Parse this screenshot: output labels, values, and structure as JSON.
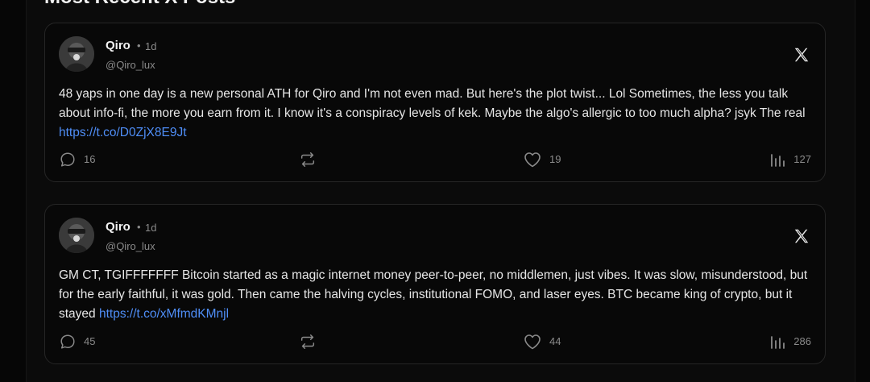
{
  "section": {
    "heading": "Most Recent X Posts"
  },
  "posts": [
    {
      "author_name": "Qiro",
      "separator": "•",
      "time_ago": "1d",
      "handle": "@Qiro_lux",
      "text": "48 yaps in one day is a new personal ATH for Qiro and I'm not even mad. But here's the plot twist... Lol Sometimes, the less you talk about info-fi, the more you earn from it. I know it's a conspiracy levels of kek. Maybe the algo's allergic to too much alpha? jsyk The real ",
      "link": "https://t.co/D0ZjX8E9Jt",
      "replies": "16",
      "likes": "19",
      "views": "127",
      "platform_icon": "x-logo-icon"
    },
    {
      "author_name": "Qiro",
      "separator": "•",
      "time_ago": "1d",
      "handle": "@Qiro_lux",
      "text": "GM CT, TGIFFFFFFF Bitcoin started as a magic internet money peer-to-peer, no middlemen, just vibes. It was slow, misunderstood, but for the early faithful, it was gold. Then came the halving cycles, institutional FOMO, and laser eyes. BTC became king of crypto, but it stayed ",
      "link": "https://t.co/xMfmdKMnjl",
      "replies": "45",
      "likes": "44",
      "views": "286",
      "platform_icon": "x-logo-icon"
    }
  ],
  "colors": {
    "background": "#060606",
    "card_background": "#080808",
    "card_border": "#262626",
    "link": "#4f8ef7",
    "muted_text": "#8a8a8a"
  }
}
